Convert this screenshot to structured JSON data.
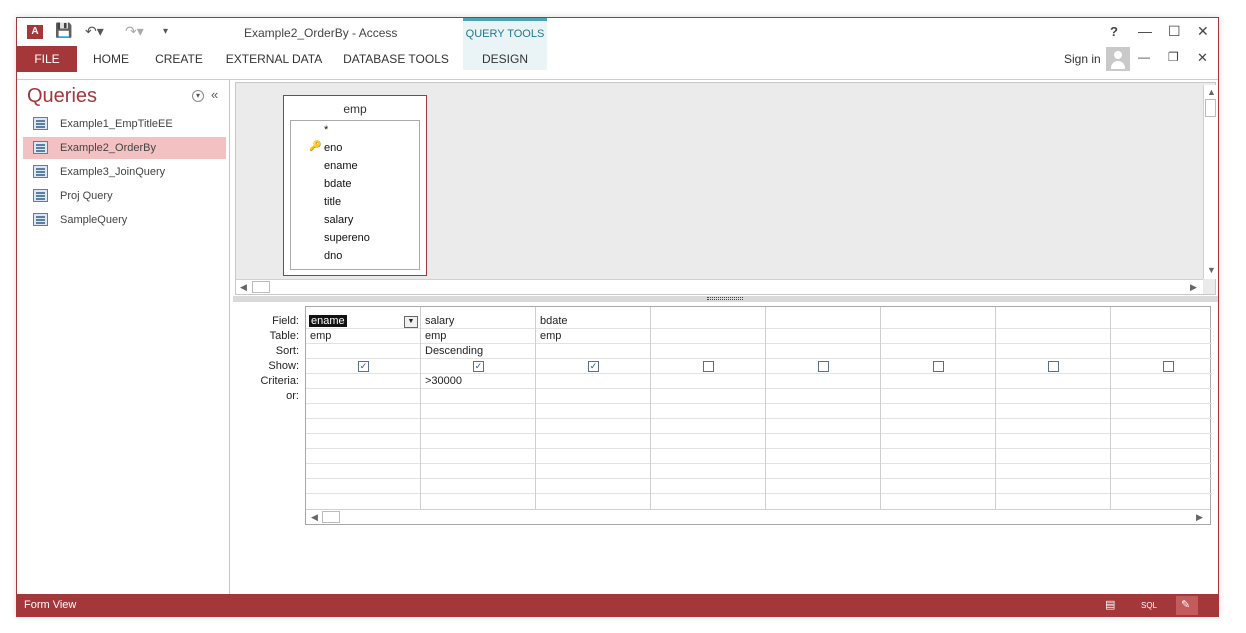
{
  "titlebar": {
    "app_icon": "A",
    "title": "Example2_OrderBy - Access",
    "context_group": "QUERY TOOLS",
    "help": "?",
    "minimize": "—",
    "maximize": "☐",
    "close": "✕"
  },
  "ribbon": {
    "tabs": [
      {
        "label": "FILE"
      },
      {
        "label": "HOME"
      },
      {
        "label": "CREATE"
      },
      {
        "label": "EXTERNAL DATA"
      },
      {
        "label": "DATABASE TOOLS"
      },
      {
        "label": "DESIGN"
      }
    ],
    "sign_in": "Sign in",
    "doc_minimize": "—",
    "doc_restore": "❐",
    "doc_close": "✕"
  },
  "nav": {
    "title": "Queries",
    "items": [
      {
        "label": "Example1_EmpTitleEE",
        "icon": "query-icon",
        "active": false
      },
      {
        "label": "Example2_OrderBy",
        "icon": "query-icon",
        "active": true
      },
      {
        "label": "Example3_JoinQuery",
        "icon": "query-icon",
        "active": false
      },
      {
        "label": "Proj Query",
        "icon": "query-icon",
        "active": false
      },
      {
        "label": "SampleQuery",
        "icon": "query-icon",
        "active": false
      }
    ]
  },
  "table": {
    "name": "emp",
    "fields": [
      "*",
      "eno",
      "ename",
      "bdate",
      "title",
      "salary",
      "supereno",
      "dno"
    ],
    "primary_key": "eno"
  },
  "grid": {
    "row_labels": [
      "Field:",
      "Table:",
      "Sort:",
      "Show:",
      "Criteria:",
      "or:"
    ],
    "columns": [
      {
        "field": "ename",
        "table": "emp",
        "sort": "",
        "show": true,
        "criteria": ""
      },
      {
        "field": "salary",
        "table": "emp",
        "sort": "Descending",
        "show": true,
        "criteria": ">30000"
      },
      {
        "field": "bdate",
        "table": "emp",
        "sort": "",
        "show": true,
        "criteria": ""
      },
      {
        "field": "",
        "table": "",
        "sort": "",
        "show": false,
        "criteria": ""
      },
      {
        "field": "",
        "table": "",
        "sort": "",
        "show": false,
        "criteria": ""
      },
      {
        "field": "",
        "table": "",
        "sort": "",
        "show": false,
        "criteria": ""
      },
      {
        "field": "",
        "table": "",
        "sort": "",
        "show": false,
        "criteria": ""
      },
      {
        "field": "",
        "table": "",
        "sort": "",
        "show": false,
        "criteria": ""
      }
    ]
  },
  "status": {
    "text": "Form View",
    "sql_label": "SQL"
  },
  "colors": {
    "accent": "#a4373a",
    "context_tab": "#4ea4b4",
    "selected_item": "#f4c1c2"
  }
}
